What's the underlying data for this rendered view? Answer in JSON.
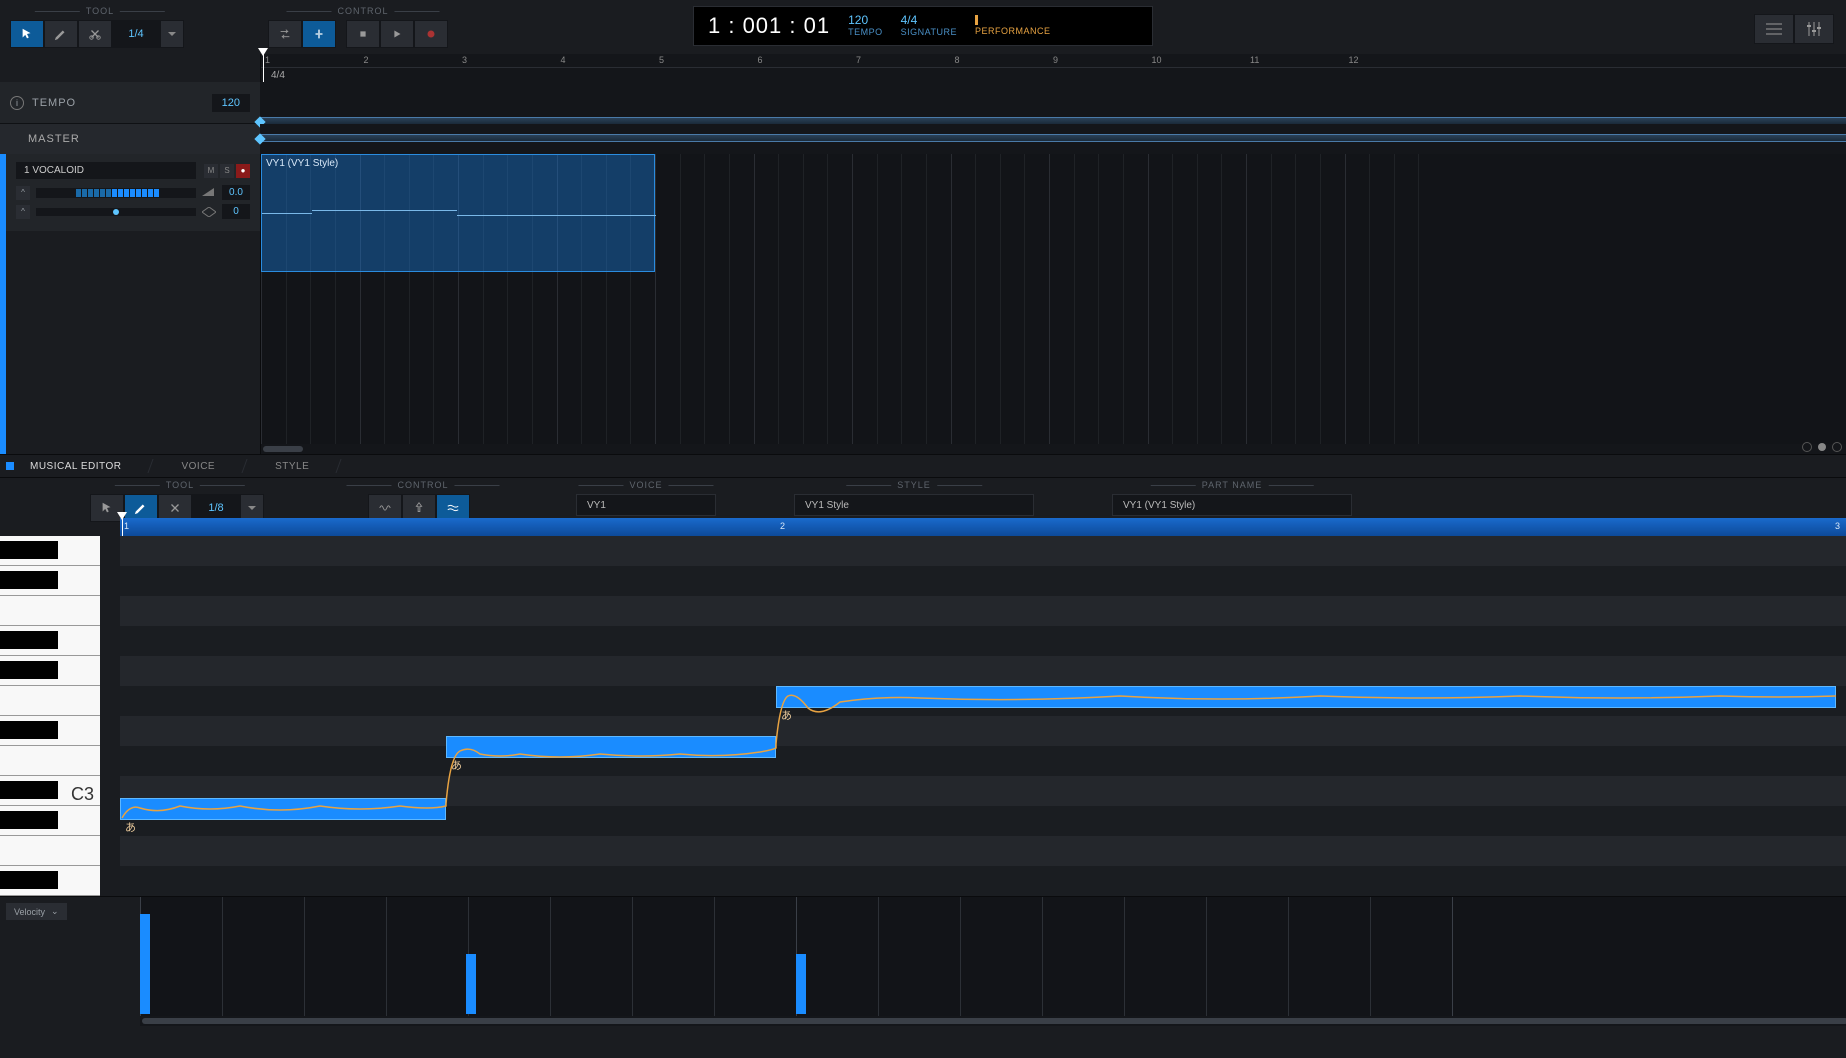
{
  "header": {
    "tool_label": "TOOL",
    "control_label": "CONTROL",
    "quant_top": "1/4",
    "transport": {
      "position": "1 : 001 : 01",
      "tempo_val": "120",
      "tempo_lbl": "TEMPO",
      "sig_val": "4/4",
      "sig_lbl": "SIGNATURE",
      "perf_lbl": "PERFORMANCE"
    }
  },
  "tempo_row": {
    "label": "TEMPO",
    "value": "120"
  },
  "master_label": "MASTER",
  "ruler_sig": "4/4",
  "bar_numbers": [
    "1",
    "2",
    "3",
    "4",
    "5",
    "6",
    "7",
    "8",
    "9",
    "10",
    "11",
    "12"
  ],
  "track": {
    "name": "1 VOCALOID",
    "m": "M",
    "s": "S",
    "vol": "0.0",
    "pan": "0"
  },
  "clip": {
    "label": "VY1 (VY1 Style)"
  },
  "editor_tabs": {
    "musical": "MUSICAL EDITOR",
    "voice": "VOICE",
    "style": "STYLE"
  },
  "editor_ctrl": {
    "tool_label": "TOOL",
    "control_label": "CONTROL",
    "quant": "1/8",
    "voice_label": "VOICE",
    "voice_val": "VY1",
    "style_label": "STYLE",
    "style_val": "VY1 Style",
    "part_label": "PART NAME",
    "part_val": "VY1 (VY1 Style)"
  },
  "ed_ruler": [
    "1",
    "2",
    "3"
  ],
  "piano_label": "C3",
  "notes": [
    {
      "lyric": "あ"
    },
    {
      "lyric": "あ"
    },
    {
      "lyric": "あ"
    }
  ],
  "velocity_label": "Velocity"
}
